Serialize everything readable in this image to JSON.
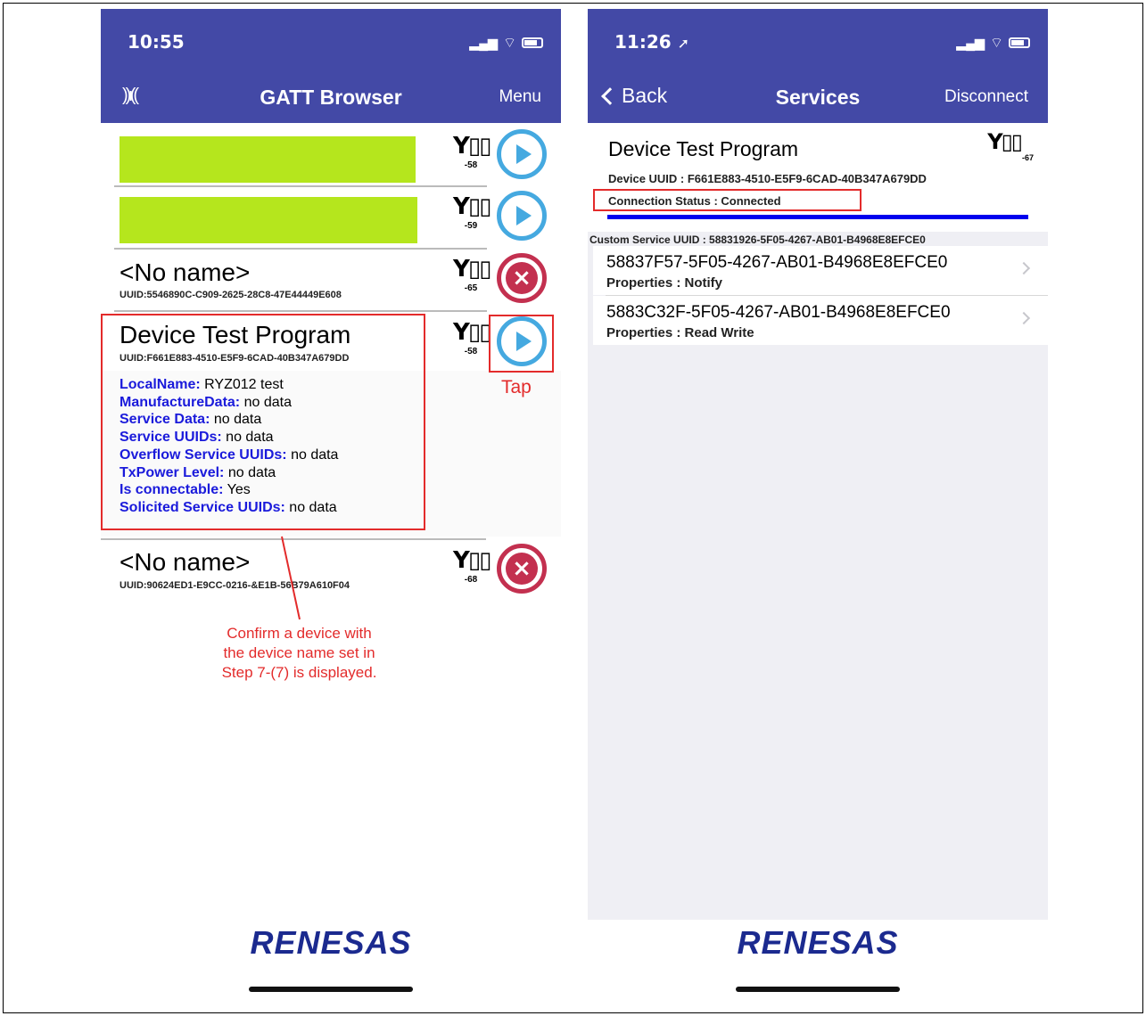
{
  "left_phone": {
    "status": {
      "time": "10:55",
      "signal_icon": "cellular-signal-icon",
      "wifi_icon": "wifi-icon",
      "battery_icon": "battery-icon"
    },
    "nav": {
      "left_icon": "radio-waves-icon",
      "title": "GATT Browser",
      "menu_label": "Menu"
    },
    "devices": [
      {
        "name": "",
        "uuid": "",
        "rssi": "-58",
        "action": "connect"
      },
      {
        "name": "",
        "uuid": "",
        "rssi": "-59",
        "action": "connect"
      },
      {
        "name": "<No name>",
        "uuid": "UUID:5546890C-C909-2625-28C8-47E44449E608",
        "rssi": "-65",
        "action": "unavailable"
      },
      {
        "name": "Device Test Program",
        "uuid": "UUID:F661E883-4510-E5F9-6CAD-40B347A679DD",
        "rssi": "-58",
        "action": "connect"
      },
      {
        "name": "<No name>",
        "uuid": "UUID:90624ED1-E9CC-0216-&E1B-56B79A610F04",
        "rssi": "-68",
        "action": "unavailable"
      }
    ],
    "advertisement": [
      {
        "key": "LocalName:",
        "value": " RYZ012 test"
      },
      {
        "key": "ManufactureData:",
        "value": " no data"
      },
      {
        "key": "Service Data:",
        "value": " no data"
      },
      {
        "key": "Service UUIDs:",
        "value": " no data"
      },
      {
        "key": "Overflow Service UUIDs:",
        "value": " no data"
      },
      {
        "key": "TxPower Level:",
        "value": " no data"
      },
      {
        "key": "Is connectable:",
        "value": " Yes"
      },
      {
        "key": "Solicited Service UUIDs:",
        "value": " no data"
      }
    ],
    "annotations": {
      "tap": "Tap",
      "confirm_line1": "Confirm a device with",
      "confirm_line2": "the device name set in",
      "confirm_line3": "Step 7-(7) is displayed."
    },
    "logo": "RENESAS"
  },
  "right_phone": {
    "status": {
      "time": "11:26",
      "location_icon": "location-arrow-icon",
      "signal_icon": "cellular-signal-icon",
      "wifi_icon": "wifi-icon",
      "battery_icon": "battery-icon"
    },
    "nav": {
      "back_label": "Back",
      "title": "Services",
      "disconnect_label": "Disconnect"
    },
    "device": {
      "name": "Device Test Program",
      "rssi": "-67",
      "uuid_line": "Device UUID : F661E883-4510-E5F9-6CAD-40B347A679DD",
      "status_line": "Connection Status :  Connected"
    },
    "service": {
      "label": "Custom Service   UUID : 58831926-5F05-4267-AB01-B4968E8EFCE0"
    },
    "characteristics": [
      {
        "uuid": "58837F57-5F05-4267-AB01-B4968E8EFCE0",
        "props": "Properties :  Notify"
      },
      {
        "uuid": "5883C32F-5F05-4267-AB01-B4968E8EFCE0",
        "props": "Properties :  Read  Write"
      }
    ],
    "logo": "RENESAS"
  },
  "colors": {
    "nav_bar": "#4349a6",
    "connect_button": "#45a9e0",
    "unavailable_button": "#c3304f",
    "annotation_red": "#e32b2b",
    "ad_key_blue": "#1a1adb",
    "masked_name": "#b5e61d",
    "status_underline": "#0000ee"
  }
}
